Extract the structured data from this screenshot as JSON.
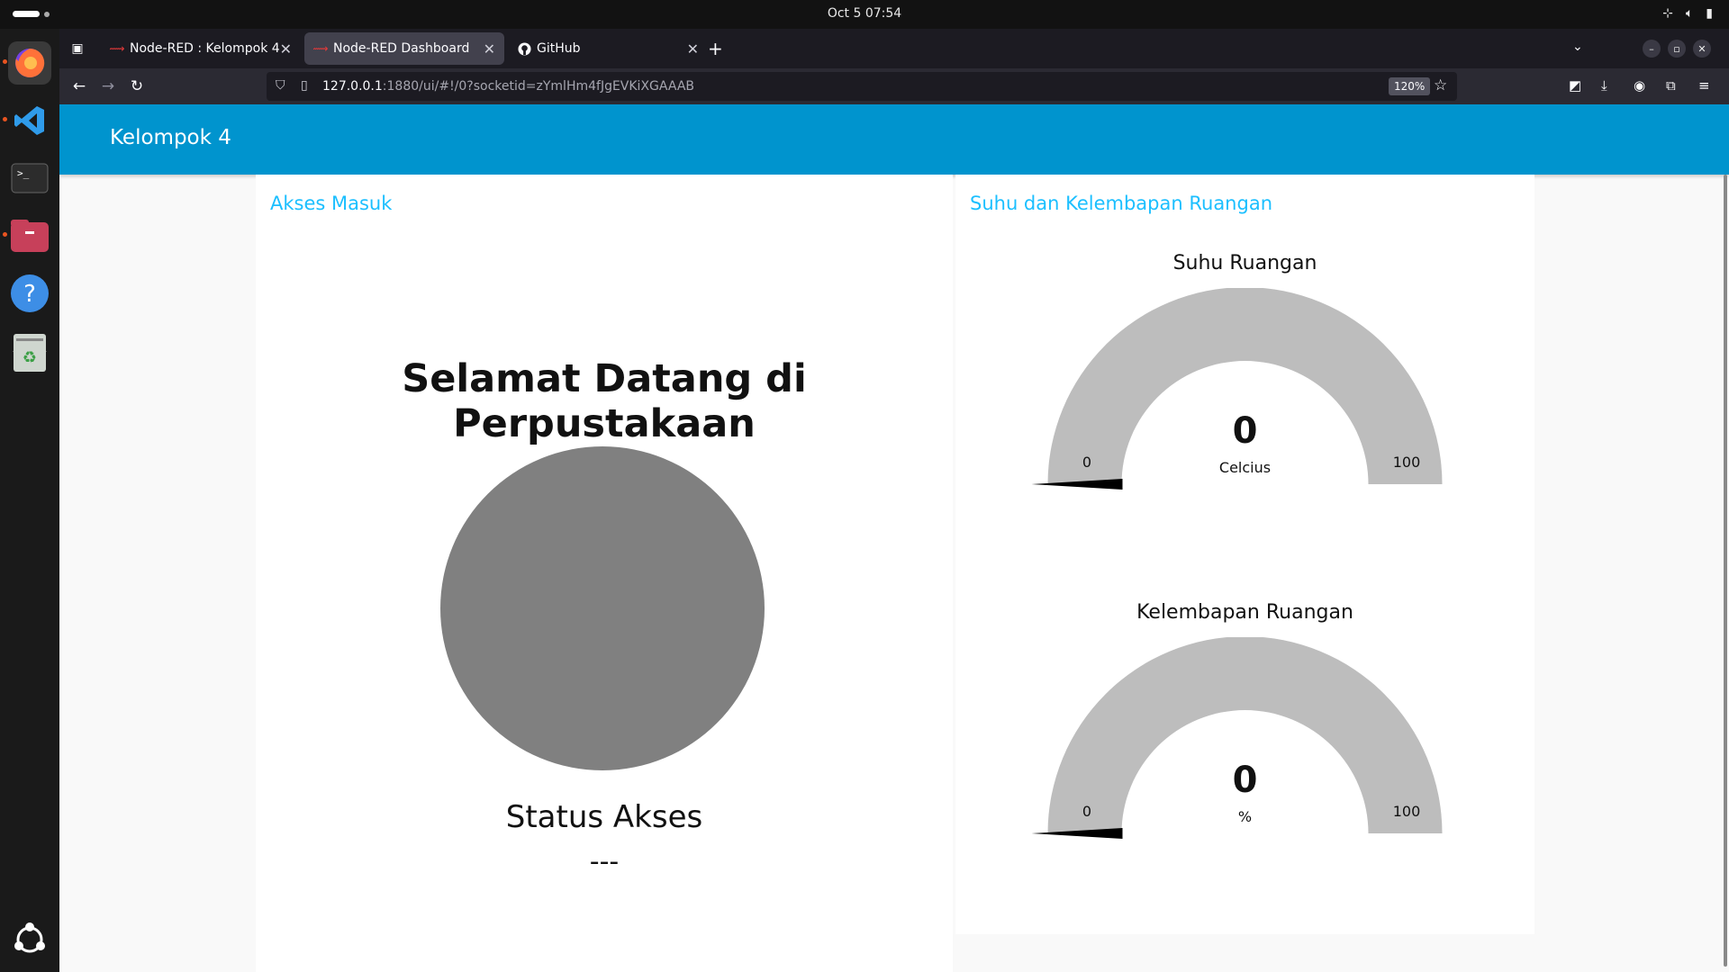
{
  "system": {
    "clock": "Oct 5  07:54",
    "tray_icons": [
      "network-icon",
      "volume-icon",
      "battery-icon"
    ]
  },
  "dock": {
    "items": [
      "firefox-icon",
      "vscode-icon",
      "terminal-icon",
      "files-icon",
      "help-icon",
      "trash-icon",
      "show-apps-icon"
    ]
  },
  "browser": {
    "tabs": [
      {
        "title": "Node-RED : Kelompok 4",
        "icon": "node-red-icon"
      },
      {
        "title": "Node-RED Dashboard",
        "icon": "node-red-dashboard-icon"
      },
      {
        "title": "GitHub",
        "icon": "github-icon"
      }
    ],
    "url_host": "127.0.0.1",
    "url_rest": ":1880/ui/#!/0?socketid=zYmlHm4fJgEVKiXGAAAB",
    "zoom": "120%"
  },
  "dashboard": {
    "title": "Kelompok 4",
    "groups": {
      "access": {
        "title": "Akses Masuk",
        "welcome": "Selamat Datang di Perpustakaan",
        "status_label": "Status Akses",
        "status_value": "---",
        "indicator_color": "#808080"
      },
      "climate": {
        "title": "Suhu dan Kelembapan Ruangan",
        "gauges": [
          {
            "label": "Suhu Ruangan",
            "value": "0",
            "units": "Celcius",
            "min": "0",
            "max": "100",
            "fraction": 0
          },
          {
            "label": "Kelembapan Ruangan",
            "value": "0",
            "units": "%",
            "min": "0",
            "max": "100",
            "fraction": 0
          }
        ]
      }
    },
    "colors": {
      "header": "#0094ce",
      "group_title": "#1bbfff",
      "gauge_track": "#bdbdbd",
      "gauge_needle": "#000000"
    }
  }
}
